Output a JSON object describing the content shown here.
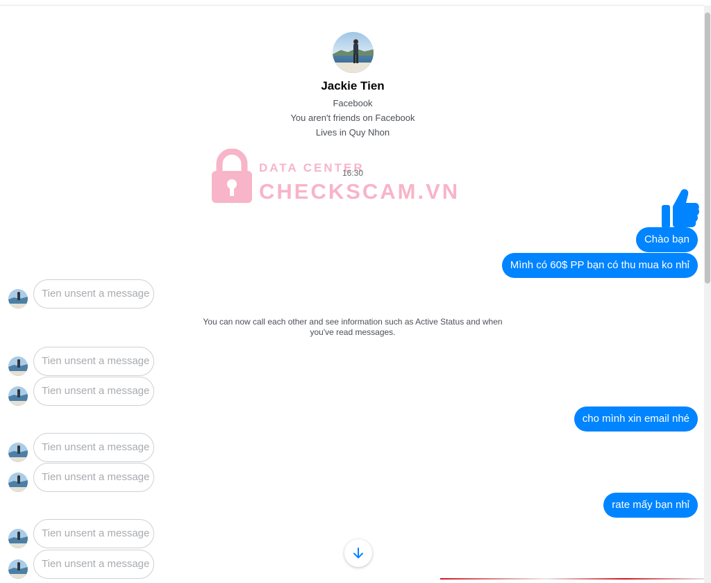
{
  "profile": {
    "name": "Jackie Tien",
    "platform": "Facebook",
    "friend_status": "You aren't friends on Facebook",
    "location": "Lives in Quy Nhon"
  },
  "watermark": {
    "line1": "DATA CENTER",
    "line2": "CHECKSCAM.VN",
    "color": "#f8b4c8"
  },
  "timestamp": "16:30",
  "like_icon": "thumbs-up-icon",
  "outgoing": [
    {
      "text": "Chào bạn"
    },
    {
      "text": "Mình có 60$ PP bạn có thu mua ko nhỉ"
    },
    {
      "text": "cho mình xin email nhé"
    },
    {
      "text": "rate mấy bạn nhỉ"
    }
  ],
  "unsent_label": "Tien unsent a message",
  "system_note": "You can now call each other and see information such as Active Status and when you've read messages.",
  "colors": {
    "accent": "#0084ff",
    "unsent_border": "#ccd0d5",
    "unsent_text": "#a8abaf"
  },
  "scroll_down_icon": "arrow-down-icon"
}
